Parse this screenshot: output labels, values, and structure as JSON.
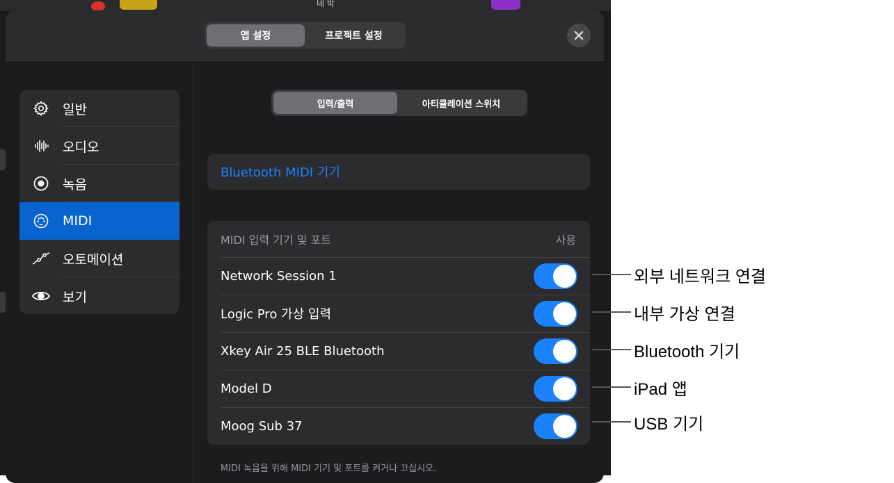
{
  "tabs_top": {
    "app_settings": "앱 설정",
    "project_settings": "프로젝트 설정"
  },
  "sidebar": {
    "items": [
      {
        "label": "일반",
        "icon": "gear-icon"
      },
      {
        "label": "오디오",
        "icon": "waveform-icon"
      },
      {
        "label": "녹음",
        "icon": "record-icon"
      },
      {
        "label": "MIDI",
        "icon": "midi-connector-icon",
        "selected": true
      },
      {
        "label": "오토메이션",
        "icon": "automation-curve-icon"
      },
      {
        "label": "보기",
        "icon": "eye-icon"
      }
    ]
  },
  "subtabs": {
    "io": "입력/출력",
    "articulation": "아티큘레이션 스위치"
  },
  "bluetooth_midi": "Bluetooth MIDI 기기",
  "ports": {
    "header": "MIDI 입력 기기 및 포트",
    "use_header": "사용",
    "rows": [
      {
        "name": "Network Session 1",
        "enabled": true,
        "callout": "외부 네트워크 연결"
      },
      {
        "name": "Logic Pro 가상 입력",
        "enabled": true,
        "callout": "내부 가상 연결"
      },
      {
        "name": "Xkey Air 25 BLE Bluetooth",
        "enabled": true,
        "callout": "Bluetooth 기기"
      },
      {
        "name": "Model D",
        "enabled": true,
        "callout": "iPad 앱"
      },
      {
        "name": "Moog Sub 37",
        "enabled": true,
        "callout": "USB 기기"
      }
    ]
  },
  "footnote": "MIDI 녹음을 위해 MIDI 기기 및 포트를 켜거나 끄십시오.",
  "background": {
    "header_text": "네 박"
  },
  "colors": {
    "accent": "#1a82ff",
    "selected": "#0a64d0",
    "panel": "#2c2c2e",
    "modal": "#1c1c1e"
  }
}
